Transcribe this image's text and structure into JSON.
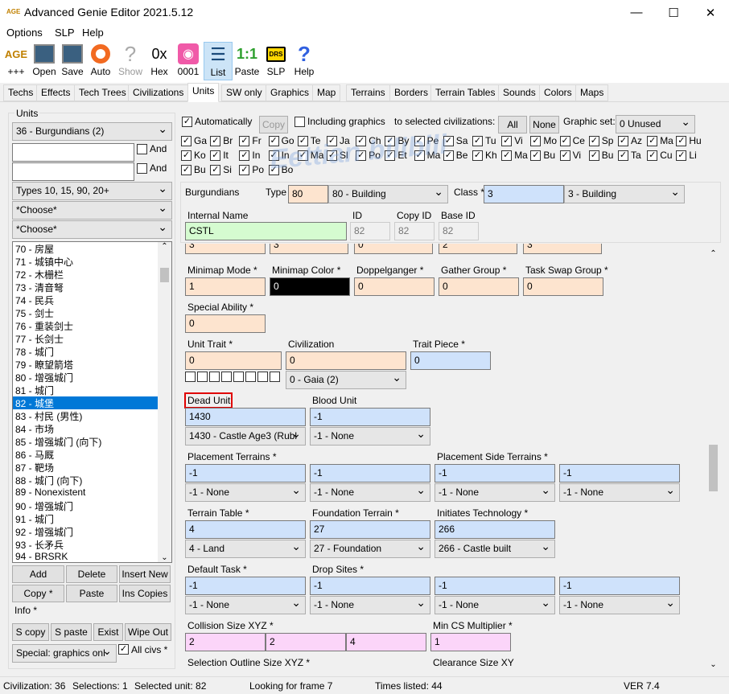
{
  "window": {
    "title": "Advanced Genie Editor 2021.5.12",
    "icon_text": "AGE",
    "minimize": "—",
    "maximize": "☐",
    "close": "✕"
  },
  "menu": [
    "Options",
    "SLP",
    "Help"
  ],
  "toolbar": [
    {
      "label": "+++",
      "icon": "age-icon",
      "glyph": "AGE"
    },
    {
      "label": "Open",
      "icon": "open-icon",
      "glyph": "▦"
    },
    {
      "label": "Save",
      "icon": "save-icon",
      "glyph": "▦"
    },
    {
      "label": "Auto",
      "icon": "lifebuoy-icon",
      "glyph": "◎"
    },
    {
      "label": "Show",
      "icon": "question-gray-icon",
      "glyph": "?"
    },
    {
      "label": "Hex",
      "icon": "hex-icon",
      "glyph": "0x"
    },
    {
      "label": "0001",
      "icon": "spiral-icon",
      "glyph": "◉"
    },
    {
      "label": "List",
      "icon": "list-icon",
      "glyph": "☰"
    },
    {
      "label": "Paste",
      "icon": "paste-icon",
      "glyph": "1:1"
    },
    {
      "label": "SLP",
      "icon": "drs-icon",
      "glyph": "DRS"
    },
    {
      "label": "Help",
      "icon": "help-icon",
      "glyph": "?"
    }
  ],
  "tabs": [
    "Techs",
    "Effects",
    "Tech Trees",
    "Civilizations",
    "Units",
    "SW only",
    "Graphics",
    "Map",
    "Terrains",
    "Borders",
    "Terrain Tables",
    "Sounds",
    "Colors",
    "Maps"
  ],
  "active_tab": "Units",
  "left": {
    "group_label": "Units",
    "civ_select": "36 - Burgundians (2)",
    "and1": "And",
    "and2": "And",
    "types": "Types 10, 15, 90, 20+",
    "choose1": "*Choose*",
    "choose2": "*Choose*",
    "list": [
      "70 - 房屋",
      "71 - 城镇中心",
      "72 - 木栅栏",
      "73 - 清音弩",
      "74 - 民兵",
      "75 - 剑士",
      "76 - 重装剑士",
      "77 - 长剑士",
      "78 - 城门",
      "79 - 瞭望箭塔",
      "80 - 增强城门",
      "81 - 城门",
      "82 - 城堡",
      "83 - 村民 (男性)",
      "84 - 市场",
      "85 - 增强城门 (向下)",
      "86 - 马厩",
      "87 - 靶场",
      "88 - 城门 (向下)",
      "89 - Nonexistent",
      "90 - 增强城门",
      "91 - 城门",
      "92 - 增强城门",
      "93 - 长矛兵",
      "94 - BRSRK"
    ],
    "selected_index": 12,
    "buttons": [
      "Add",
      "Delete",
      "Insert New",
      "Copy *",
      "Paste",
      "Ins Copies"
    ],
    "info_label": "Info *",
    "buttons2": [
      "S copy",
      "S paste",
      "Exist",
      "Wipe Out"
    ],
    "special_select": "Special: graphics onl",
    "all_civs": "All civs *"
  },
  "top": {
    "automatically": "Automatically",
    "copy": "Copy",
    "including_graphics": "Including graphics",
    "to_selected": "to selected civilizations:",
    "all": "All",
    "none": "None",
    "graphic_set_label": "Graphic set:",
    "graphic_set": "0 Unused",
    "civs_row1": [
      "Ga",
      "Br",
      "Fr",
      "Go",
      "Te",
      "Ja",
      "Ch",
      "By",
      "Pe",
      "Sa",
      "Tu",
      "Vi",
      "Mo",
      "Ce",
      "Sp",
      "Az",
      "Ma",
      "Hu"
    ],
    "civs_row2": [
      "Ko",
      "It",
      "In",
      "In",
      "Ma",
      "Sl",
      "Po",
      "Et",
      "Ma",
      "Be",
      "Kh",
      "Ma",
      "Bu",
      "Vi",
      "Bu",
      "Ta",
      "Cu",
      "Li"
    ],
    "civs_row3": [
      "Bu",
      "Si",
      "Po",
      "Bo"
    ]
  },
  "header": {
    "civ_name": "Burgundians",
    "type_label": "Type",
    "type_value": "80",
    "type_select": "80 - Building",
    "class_label": "Class *",
    "class_value": "3",
    "class_select": "3 - Building",
    "internal_name_label": "Internal Name",
    "internal_name": "CSTL",
    "id_label": "ID",
    "id": "82",
    "copy_id_label": "Copy ID",
    "copy_id": "82",
    "base_id_label": "Base ID",
    "base_id": "82"
  },
  "form": {
    "partial_row": [
      "3",
      "3",
      "0",
      "2",
      "3"
    ],
    "minimap_mode_label": "Minimap Mode *",
    "minimap_mode": "1",
    "minimap_color_label": "Minimap Color *",
    "minimap_color": "0",
    "doppelganger_label": "Doppelganger *",
    "doppelganger": "0",
    "gather_group_label": "Gather Group *",
    "gather_group": "0",
    "task_swap_label": "Task Swap Group *",
    "task_swap": "0",
    "special_ability_label": "Special Ability *",
    "special_ability": "0",
    "unit_trait_label": "Unit Trait *",
    "unit_trait": "0",
    "civilization_label": "Civilization",
    "civilization": "0",
    "civilization_select": "0 - Gaia (2)",
    "trait_piece_label": "Trait Piece *",
    "trait_piece": "0",
    "dead_unit_label": "Dead Unit",
    "dead_unit": "1430",
    "dead_unit_select": "1430 - Castle Age3 (Rubl",
    "blood_unit_label": "Blood Unit",
    "blood_unit": "-1",
    "blood_unit_select": "-1 - None",
    "placement_terrains_label": "Placement Terrains *",
    "placement_terrains": [
      "-1",
      "-1"
    ],
    "placement_terrains_select": [
      "-1 - None",
      "-1 - None"
    ],
    "placement_side_label": "Placement Side Terrains *",
    "placement_side": [
      "-1",
      "-1"
    ],
    "placement_side_select": [
      "-1 - None",
      "-1 - None"
    ],
    "terrain_table_label": "Terrain Table *",
    "terrain_table": "4",
    "terrain_table_select": "4 - Land",
    "foundation_terrain_label": "Foundation Terrain *",
    "foundation_terrain": "27",
    "foundation_terrain_select": "27 - Foundation",
    "initiates_tech_label": "Initiates Technology *",
    "initiates_tech": "266",
    "initiates_tech_select": "266 - Castle built",
    "default_task_label": "Default Task *",
    "default_task": "-1",
    "default_task_select": "-1 - None",
    "drop_sites_label": "Drop Sites *",
    "drop_sites": [
      "-1",
      "-1",
      "-1"
    ],
    "drop_sites_select": [
      "-1 - None",
      "-1 - None",
      "-1 - None"
    ],
    "collision_label": "Collision Size XYZ *",
    "collision": [
      "2",
      "2",
      "4"
    ],
    "min_cs_label": "Min CS Multiplier *",
    "min_cs": "1",
    "selection_outline_label": "Selection Outline Size XYZ *",
    "clearance_label": "Clearance Size XY"
  },
  "watermark": "Eettian bilibili",
  "status": {
    "civilization": "Civilization: 36",
    "selections": "Selections: 1",
    "selected_unit": "Selected unit: 82",
    "looking": "Looking for frame 7",
    "times_listed": "Times listed: 44",
    "ver": "VER 7.4"
  },
  "colors": {
    "peach": "#fde4cf",
    "blue": "#cfe2fb",
    "green": "#d5fbd0",
    "pink": "#fbd5f9",
    "highlight": "#e00000",
    "select": "#0078d7"
  }
}
